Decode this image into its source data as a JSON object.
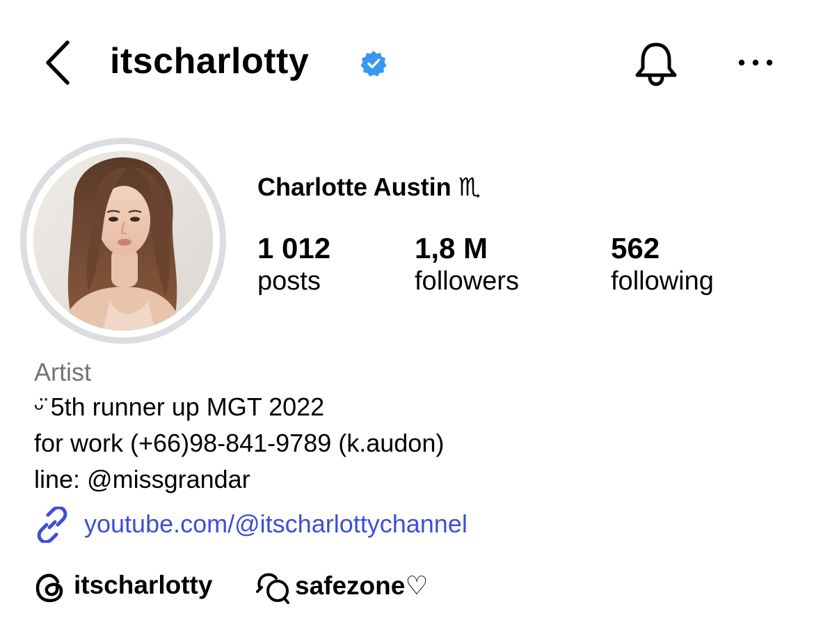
{
  "header": {
    "username": "itscharlotty",
    "verified": true,
    "back_icon": "chevron-left-icon",
    "bell_icon": "bell-icon",
    "more_icon": "more-horizontal-icon"
  },
  "profile": {
    "display_name": "Charlotte Austin",
    "name_emoji": "♏",
    "stats": [
      {
        "value": "1 012",
        "label": "posts"
      },
      {
        "value": "1,8 M",
        "label": "followers"
      },
      {
        "value": "562",
        "label": "following"
      }
    ]
  },
  "bio": {
    "category": "Artist",
    "lines": [
      "ᵕ̈ 5th runner up MGT 2022",
      "for work (+66)98-841-9789 (k.audon)",
      "line: @missgrandar"
    ],
    "link": "youtube.com/@itscharlottychannel"
  },
  "bottom": {
    "threads_handle": "itscharlotty",
    "broadcast_name": "safezone♡"
  },
  "colors": {
    "verified": "#3897f0",
    "category": "#737373",
    "link": "#3d4fd6",
    "ring": "#dcdde2"
  }
}
